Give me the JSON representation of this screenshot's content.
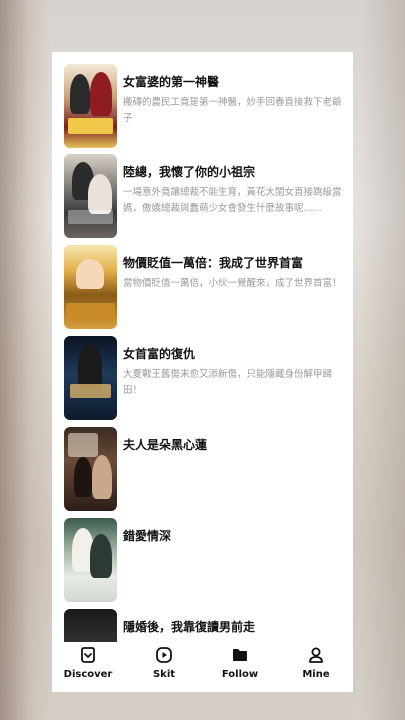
{
  "items": [
    {
      "title": "女富婆的第一神醫",
      "desc": "搬磚的農民工竟是第一神醫，妙手回春直接救下老爺子",
      "cover_colors": [
        "#7a1f1f",
        "#e8c35a",
        "#2a2a6a"
      ],
      "cover_caption": ""
    },
    {
      "title": "陸總，我懷了你的小祖宗",
      "desc": "一場意外竟讓總裁不能生育，黃花大閨女直接跳級當媽，傲嬌總裁與蠢萌少女會發生什麼故事呢......",
      "cover_colors": [
        "#3b3b3b",
        "#b5b1ab",
        "#d9d3cb"
      ],
      "cover_caption": ""
    },
    {
      "title": "物價貶值一萬倍：我成了世界首富",
      "desc": "當物價貶值一萬倍，小伙一覺醒來，成了世界首富！",
      "cover_colors": [
        "#6b4a12",
        "#e3b24a",
        "#c98a2a"
      ],
      "cover_caption": ""
    },
    {
      "title": "女首富的復仇",
      "desc": "大夏戰王舊傷未愈又添新傷，只能隱藏身份解甲歸田！",
      "cover_colors": [
        "#0f1a2e",
        "#1f3b5a",
        "#d8b36a"
      ],
      "cover_caption": ""
    },
    {
      "title": "夫人是朵黑心蓮",
      "desc": "",
      "cover_colors": [
        "#2b1e18",
        "#6a4c3a",
        "#c8a88a"
      ],
      "cover_caption": ""
    },
    {
      "title": "錯愛情深",
      "desc": "",
      "cover_colors": [
        "#2d4a3a",
        "#cfd8cf",
        "#a5b8a8"
      ],
      "cover_caption": ""
    },
    {
      "title": "隱婚後，我靠復讀男前走",
      "desc": "",
      "cover_colors": [
        "#1a1a1a",
        "#555555",
        "#888888"
      ],
      "cover_caption": ""
    }
  ],
  "tabbar": {
    "tabs": [
      {
        "label": "Discover",
        "icon": "discover-icon"
      },
      {
        "label": "Skit",
        "icon": "play-circle-icon"
      },
      {
        "label": "Follow",
        "icon": "folder-icon"
      },
      {
        "label": "Mine",
        "icon": "person-icon"
      }
    ]
  }
}
